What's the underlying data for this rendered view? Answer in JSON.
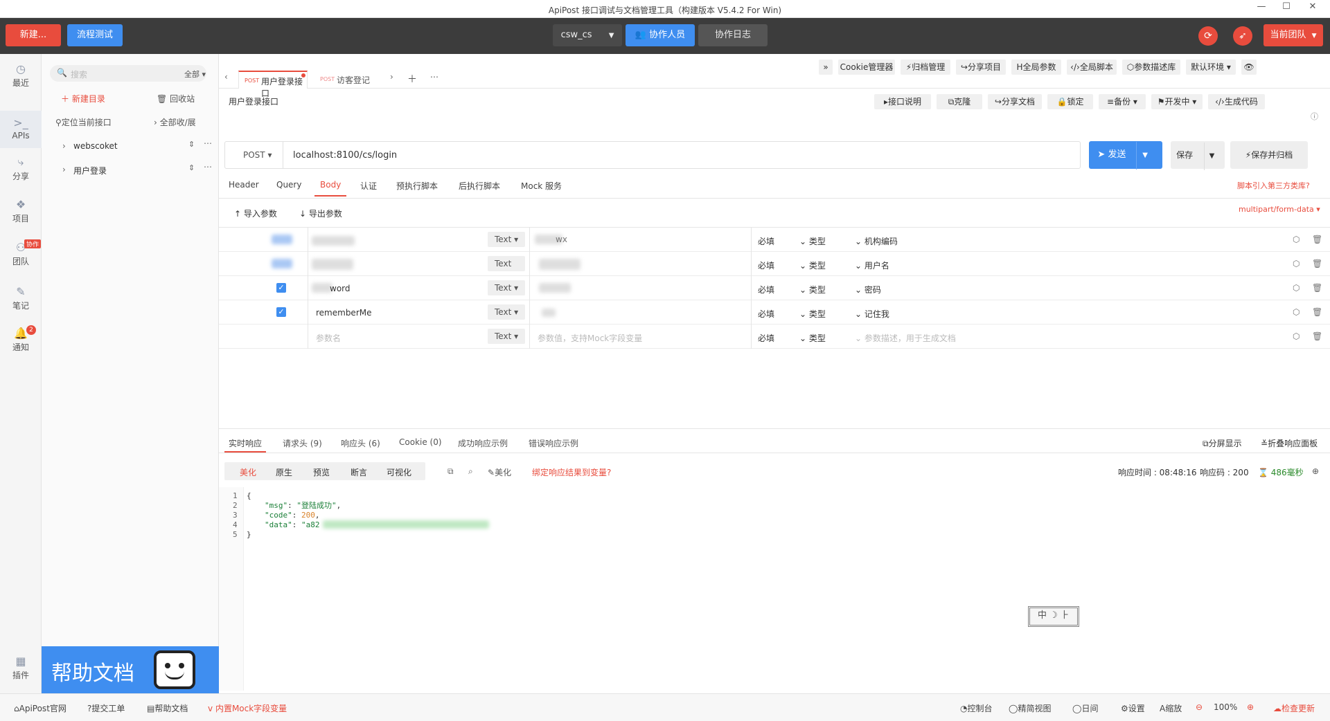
{
  "window": {
    "title": "ApiPost 接口调试与文档管理工具（构建版本 V5.4.2 For Win)"
  },
  "topbar": {
    "new_label": "新建...",
    "flow_test_label": "流程测试",
    "project_select": "csw_cs",
    "collaborators_label": "协作人员",
    "collab_log_label": "协作日志",
    "current_team_label": "当前团队"
  },
  "rail": {
    "recent": "最近",
    "apis": "APIs",
    "share": "分享",
    "project": "项目",
    "team": "团队",
    "team_badge": "协作",
    "notes": "笔记",
    "notify": "通知",
    "notify_count": "2",
    "plugins": "插件"
  },
  "tree": {
    "search_placeholder": "搜索",
    "filter_label": "全部",
    "new_dir": "新建目录",
    "recycle": "回收站",
    "locate": "定位当前接口",
    "expand": "全部收/展",
    "items": [
      "webscoket",
      "用户登录"
    ],
    "help_banner": "帮助文档"
  },
  "toolbar": {
    "cookie": "Cookie管理器",
    "archive": "归档管理",
    "share_project": "分享项目",
    "global_params": "全局参数",
    "global_script": "全局脚本",
    "param_lib": "参数描述库",
    "env": "默认环境"
  },
  "tabs": [
    {
      "method": "POST",
      "name": "用户登录接口"
    },
    {
      "method": "POST",
      "name": "访客登记"
    }
  ],
  "request": {
    "name": "用户登录接口",
    "actions": {
      "desc": "接口说明",
      "clone": "克隆",
      "share_doc": "分享文档",
      "lock": "锁定",
      "backup": "备份",
      "dev_status": "开发中",
      "gen_code": "生成代码"
    },
    "method": "POST",
    "url": "localhost:8100/cs/login",
    "send_label": "发送",
    "save_label": "保存",
    "save_archive_label": "保存并归档"
  },
  "req_tabs": [
    "Header",
    "Query",
    "Body",
    "认证",
    "预执行脚本",
    "后执行脚本",
    "Mock 服务"
  ],
  "req_tab_hint": "脚本引入第三方类库?",
  "body": {
    "import_label": "导入参数",
    "export_label": "导出参数",
    "content_type": "multipart/form-data",
    "rows": [
      {
        "name": "",
        "type": "Text",
        "value": "wx",
        "required": "必填",
        "vtype": "类型",
        "desc": "机构编码"
      },
      {
        "name": "",
        "type": "Text",
        "value": "",
        "required": "必填",
        "vtype": "类型",
        "desc": "用户名"
      },
      {
        "name": "word",
        "type": "Text",
        "value": "",
        "required": "必填",
        "vtype": "类型",
        "desc": "密码"
      },
      {
        "name": "rememberMe",
        "type": "Text",
        "value": "",
        "required": "必填",
        "vtype": "类型",
        "desc": "记住我"
      }
    ],
    "empty_row": {
      "name_placeholder": "参数名",
      "type": "Text",
      "value_placeholder": "参数值，支持Mock字段变量",
      "required": "必填",
      "vtype": "类型",
      "desc_placeholder": "参数描述，用于生成文档"
    }
  },
  "response": {
    "tabs": [
      "实时响应",
      "请求头 (9)",
      "响应头 (6)",
      "Cookie (0)",
      "成功响应示例",
      "错误响应示例"
    ],
    "fullscreen": "分屏显示",
    "collapse": "折叠响应面板",
    "view_modes": [
      "美化",
      "原生",
      "预览",
      "断言",
      "可视化"
    ],
    "beautify": "美化",
    "bind_var": "绑定响应结果到变量?",
    "time_label": "响应时间 : 08:48:16",
    "code_label": "响应码 : 200",
    "duration": "486毫秒",
    "lines": [
      "1",
      "2",
      "3",
      "4",
      "5"
    ],
    "json_msg_key": "\"msg\"",
    "json_msg_val": "\"登陆成功\"",
    "json_code_key": "\"code\"",
    "json_code_val": "200",
    "json_data_key": "\"data\"",
    "json_data_val": "\"a82",
    "ime": "中 ☽ ⺊"
  },
  "status": {
    "site": "ApiPost官网",
    "ticket": "提交工单",
    "help": "帮助文档",
    "mock": "内置Mock字段变量",
    "console": "控制台",
    "compact": "精简视图",
    "daylight": "日间",
    "settings": "设置",
    "zoom": "缩放",
    "zoom_value": "100%",
    "check_update": "检查更新"
  }
}
